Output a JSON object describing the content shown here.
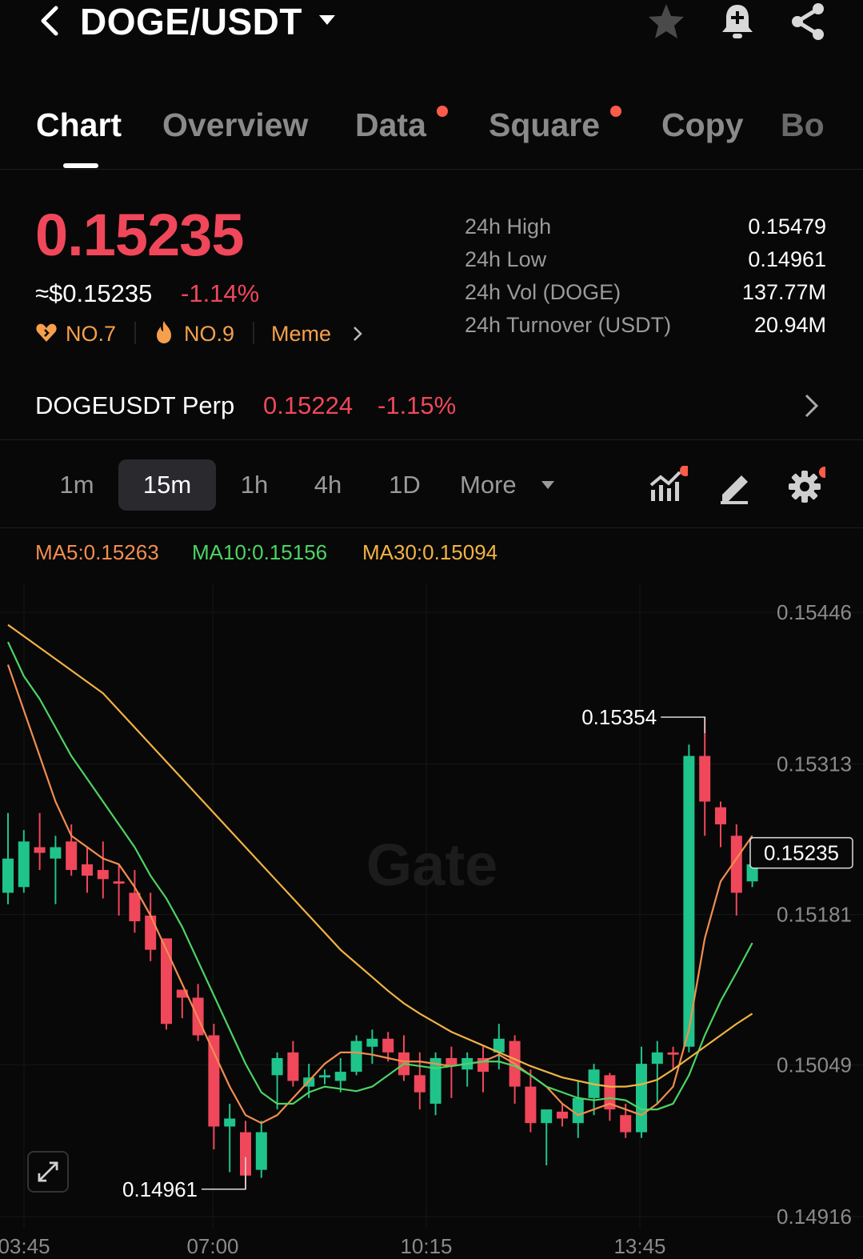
{
  "header": {
    "pair": "DOGE/USDT",
    "icons": [
      "back-icon",
      "dropdown-caret-icon",
      "star-icon",
      "bell-plus-icon",
      "share-icon"
    ]
  },
  "tabs": [
    {
      "label": "Chart",
      "active": true,
      "dot": false
    },
    {
      "label": "Overview",
      "active": false,
      "dot": false
    },
    {
      "label": "Data",
      "active": false,
      "dot": true
    },
    {
      "label": "Square",
      "active": false,
      "dot": true
    },
    {
      "label": "Copy",
      "active": false,
      "dot": false
    },
    {
      "label": "Bo",
      "active": false,
      "dot": false
    }
  ],
  "price": {
    "last": "0.15235",
    "usd": "≈$0.15235",
    "change": "-1.14%",
    "tags": [
      {
        "icon": "heart-icon",
        "label": "NO.7"
      },
      {
        "icon": "flame-icon",
        "label": "NO.9"
      },
      {
        "icon": "chevron-right-icon",
        "label": "Meme"
      }
    ]
  },
  "stats": [
    {
      "label": "24h High",
      "value": "0.15479"
    },
    {
      "label": "24h Low",
      "value": "0.14961"
    },
    {
      "label": "24h Vol (DOGE)",
      "value": "137.77M"
    },
    {
      "label": "24h Turnover (USDT)",
      "value": "20.94M"
    }
  ],
  "perp": {
    "name": "DOGEUSDT Perp",
    "price": "0.15224",
    "change": "-1.15%"
  },
  "intervals": [
    "1m",
    "15m",
    "1h",
    "4h",
    "1D",
    "More"
  ],
  "active_interval": "15m",
  "tools": [
    "indicators-icon",
    "draw-pen-icon",
    "settings-gear-icon"
  ],
  "ma_legend": [
    {
      "label": "MA5:0.15263",
      "color": "#f28d4f"
    },
    {
      "label": "MA10:0.15156",
      "color": "#4cd463"
    },
    {
      "label": "MA30:0.15094",
      "color": "#f1b343"
    }
  ],
  "colors": {
    "up": "#1fc48b",
    "down": "#f0475a",
    "bg": "#080808"
  },
  "chart_data": {
    "type": "candlestick",
    "watermark": "Gate",
    "ylim": [
      0.14916,
      0.15446
    ],
    "y_ticks": [
      "0.15446",
      "0.15313",
      "0.15181",
      "0.15049",
      "0.14916"
    ],
    "x_ticks": [
      "03:45",
      "07:00",
      "10:15",
      "13:45"
    ],
    "last_price_label": "0.15235",
    "high_annotation": "0.15354",
    "low_annotation": "0.14961",
    "candles": [
      {
        "o": 0.152,
        "h": 0.1527,
        "l": 0.1519,
        "c": 0.1523
      },
      {
        "o": 0.15205,
        "h": 0.15255,
        "l": 0.152,
        "c": 0.15245
      },
      {
        "o": 0.1524,
        "h": 0.1527,
        "l": 0.1522,
        "c": 0.15235
      },
      {
        "o": 0.1523,
        "h": 0.1525,
        "l": 0.1519,
        "c": 0.1524
      },
      {
        "o": 0.15245,
        "h": 0.1526,
        "l": 0.15215,
        "c": 0.1522
      },
      {
        "o": 0.15225,
        "h": 0.1524,
        "l": 0.152,
        "c": 0.15215
      },
      {
        "o": 0.1522,
        "h": 0.15245,
        "l": 0.15195,
        "c": 0.15212
      },
      {
        "o": 0.1521,
        "h": 0.15225,
        "l": 0.1518,
        "c": 0.15208
      },
      {
        "o": 0.152,
        "h": 0.1522,
        "l": 0.15165,
        "c": 0.15175
      },
      {
        "o": 0.1518,
        "h": 0.152,
        "l": 0.1514,
        "c": 0.1515
      },
      {
        "o": 0.1516,
        "h": 0.1515,
        "l": 0.1508,
        "c": 0.15085
      },
      {
        "o": 0.15115,
        "h": 0.15115,
        "l": 0.1509,
        "c": 0.15108
      },
      {
        "o": 0.15108,
        "h": 0.1512,
        "l": 0.1507,
        "c": 0.15075
      },
      {
        "o": 0.15075,
        "h": 0.15085,
        "l": 0.14975,
        "c": 0.14995
      },
      {
        "o": 0.14995,
        "h": 0.15015,
        "l": 0.14955,
        "c": 0.15002
      },
      {
        "o": 0.1499,
        "h": 0.15,
        "l": 0.1494,
        "c": 0.14952
      },
      {
        "o": 0.14957,
        "h": 0.15,
        "l": 0.1495,
        "c": 0.1499
      },
      {
        "o": 0.1504,
        "h": 0.1506,
        "l": 0.1501,
        "c": 0.15055
      },
      {
        "o": 0.1506,
        "h": 0.1507,
        "l": 0.1503,
        "c": 0.15035
      },
      {
        "o": 0.1503,
        "h": 0.1505,
        "l": 0.1502,
        "c": 0.15038
      },
      {
        "o": 0.15038,
        "h": 0.15045,
        "l": 0.15032,
        "c": 0.1504
      },
      {
        "o": 0.15035,
        "h": 0.15055,
        "l": 0.15025,
        "c": 0.15043
      },
      {
        "o": 0.15043,
        "h": 0.15075,
        "l": 0.1504,
        "c": 0.1507
      },
      {
        "o": 0.15065,
        "h": 0.1508,
        "l": 0.1505,
        "c": 0.15072
      },
      {
        "o": 0.15072,
        "h": 0.15078,
        "l": 0.15052,
        "c": 0.1506
      },
      {
        "o": 0.1506,
        "h": 0.15075,
        "l": 0.15035,
        "c": 0.1504
      },
      {
        "o": 0.1504,
        "h": 0.1506,
        "l": 0.1501,
        "c": 0.15025
      },
      {
        "o": 0.15015,
        "h": 0.1506,
        "l": 0.15005,
        "c": 0.15055
      },
      {
        "o": 0.15055,
        "h": 0.15065,
        "l": 0.1502,
        "c": 0.15048
      },
      {
        "o": 0.15045,
        "h": 0.1506,
        "l": 0.1503,
        "c": 0.15055
      },
      {
        "o": 0.15055,
        "h": 0.15065,
        "l": 0.15025,
        "c": 0.15043
      },
      {
        "o": 0.1506,
        "h": 0.15085,
        "l": 0.15045,
        "c": 0.15072
      },
      {
        "o": 0.1507,
        "h": 0.15075,
        "l": 0.15015,
        "c": 0.1503
      },
      {
        "o": 0.1503,
        "h": 0.15045,
        "l": 0.1499,
        "c": 0.14998
      },
      {
        "o": 0.14998,
        "h": 0.15002,
        "l": 0.14961,
        "c": 0.1501
      },
      {
        "o": 0.15008,
        "h": 0.15015,
        "l": 0.14995,
        "c": 0.15002
      },
      {
        "o": 0.14998,
        "h": 0.15035,
        "l": 0.14985,
        "c": 0.1502
      },
      {
        "o": 0.1502,
        "h": 0.1505,
        "l": 0.15005,
        "c": 0.15045
      },
      {
        "o": 0.1504,
        "h": 0.15042,
        "l": 0.15,
        "c": 0.1501
      },
      {
        "o": 0.15005,
        "h": 0.15015,
        "l": 0.14985,
        "c": 0.1499
      },
      {
        "o": 0.1499,
        "h": 0.15065,
        "l": 0.14985,
        "c": 0.1505
      },
      {
        "o": 0.1505,
        "h": 0.1507,
        "l": 0.15015,
        "c": 0.1506
      },
      {
        "o": 0.1506,
        "h": 0.15065,
        "l": 0.15045,
        "c": 0.15058
      },
      {
        "o": 0.15065,
        "h": 0.1533,
        "l": 0.1506,
        "c": 0.1532
      },
      {
        "o": 0.1532,
        "h": 0.15354,
        "l": 0.1525,
        "c": 0.1528
      },
      {
        "o": 0.15275,
        "h": 0.1528,
        "l": 0.1524,
        "c": 0.1526
      },
      {
        "o": 0.1525,
        "h": 0.1526,
        "l": 0.1518,
        "c": 0.152
      },
      {
        "o": 0.1521,
        "h": 0.1524,
        "l": 0.15205,
        "c": 0.15225
      }
    ],
    "ma5": [
      0.154,
      0.1536,
      0.1532,
      0.1528,
      0.1525,
      0.1524,
      0.1523,
      0.15225,
      0.15205,
      0.1518,
      0.1515,
      0.1512,
      0.1509,
      0.1506,
      0.1503,
      0.15005,
      0.14998,
      0.15005,
      0.1502,
      0.15035,
      0.1505,
      0.1506,
      0.1506,
      0.15058,
      0.15055,
      0.15052,
      0.15052,
      0.1505,
      0.15048,
      0.1505,
      0.15052,
      0.15058,
      0.1505,
      0.1504,
      0.1503,
      0.15015,
      0.15005,
      0.1501,
      0.15015,
      0.1501,
      0.15005,
      0.15015,
      0.1503,
      0.1508,
      0.1516,
      0.1521,
      0.1523,
      0.1525
    ],
    "ma10": [
      0.1542,
      0.1539,
      0.1537,
      0.15345,
      0.1532,
      0.153,
      0.1528,
      0.1526,
      0.1524,
      0.15215,
      0.15195,
      0.1517,
      0.1514,
      0.1511,
      0.1508,
      0.1505,
      0.15025,
      0.15015,
      0.15015,
      0.15025,
      0.1503,
      0.15028,
      0.15026,
      0.1503,
      0.1504,
      0.1505,
      0.15048,
      0.15046,
      0.15048,
      0.1505,
      0.15052,
      0.15052,
      0.15048,
      0.1504,
      0.1503,
      0.15025,
      0.1502,
      0.15018,
      0.1502,
      0.15018,
      0.1501,
      0.1501,
      0.15015,
      0.1504,
      0.15075,
      0.15105,
      0.1513,
      0.15156
    ],
    "ma30": [
      0.15435,
      0.15425,
      0.15415,
      0.15405,
      0.15395,
      0.15385,
      0.15375,
      0.1536,
      0.15345,
      0.1533,
      0.15315,
      0.153,
      0.15285,
      0.1527,
      0.15255,
      0.1524,
      0.15225,
      0.1521,
      0.15195,
      0.1518,
      0.15165,
      0.1515,
      0.15138,
      0.15126,
      0.15114,
      0.15103,
      0.15094,
      0.15086,
      0.15078,
      0.15072,
      0.15066,
      0.1506,
      0.15054,
      0.15048,
      0.15043,
      0.15038,
      0.15035,
      0.15032,
      0.1503,
      0.1503,
      0.15032,
      0.15036,
      0.15045,
      0.15055,
      0.15065,
      0.15075,
      0.15085,
      0.15094
    ]
  }
}
